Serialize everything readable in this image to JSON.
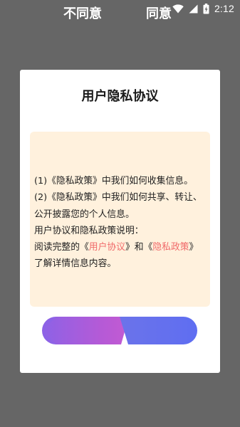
{
  "status_bar": {
    "time": "2:12",
    "icons": [
      "wifi-icon",
      "signal-icon",
      "battery-icon"
    ]
  },
  "dialog": {
    "title": "用户隐私协议",
    "lines": [
      {
        "text": "(1)《隐私政策》中我们如何收集信息。"
      },
      {
        "text": "(2)《隐私政策》中我们如何共享、转让、"
      },
      {
        "text": "公开披露您的个人信息。"
      },
      {
        "text": "用户协议和隐私政策说明："
      },
      {
        "prefix": "阅读完整的",
        "open1": "《",
        "link1": "用户协议",
        "close1": "》和《",
        "link2": "隐私政策",
        "close2": "》"
      },
      {
        "text": "了解详情信息内容。"
      }
    ],
    "buttons": {
      "disagree": "不同意",
      "agree": "同意"
    }
  },
  "colors": {
    "overlay": "#666666",
    "dialog_bg": "#ffffff",
    "content_bg": "#fff1dd",
    "link": "#f06a6a",
    "disagree_gradient_start": "#8d62e6",
    "disagree_gradient_end": "#c35bd2",
    "agree_gradient": "#5f6ef1"
  }
}
